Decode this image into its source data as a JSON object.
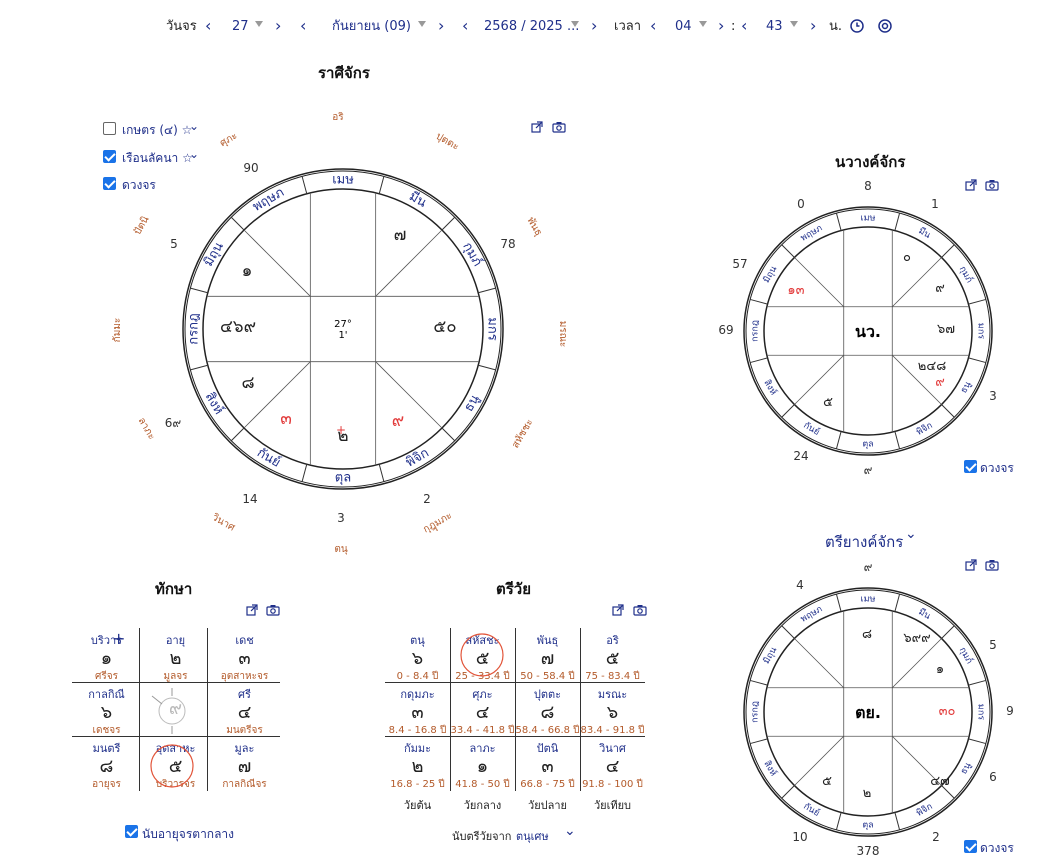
{
  "toolbar": {
    "day_label": "วันจร",
    "day_value": "27",
    "month_value": "กันยายน (09)",
    "year_value": "2568 / 2025 ...",
    "time_label": "เวลา",
    "hour_value": "04",
    "colon": ":",
    "minute_value": "43",
    "suffix": "น."
  },
  "rasi": {
    "title": "ราศีจักร",
    "options": [
      {
        "label": "เกษตร (๔) ☆",
        "checked": false
      },
      {
        "label": "เรือนลัคนา ☆",
        "checked": true
      },
      {
        "label": "ดวงจร",
        "checked": true
      }
    ],
    "signs": [
      "เมษ",
      "มีน",
      "กุมภ์",
      "มกร",
      "ธนู",
      "พิจิก",
      "ตุล",
      "กันย์",
      "สิงห์",
      "กรกฎ",
      "มิถุน",
      "พฤษภ"
    ],
    "center_deg": "27°",
    "center_min": "1'",
    "house_nums": [
      "๗",
      "๕๐",
      "๙",
      "๒",
      "๓",
      "๘",
      "๔๖๙",
      "๑"
    ],
    "outer_nums": [
      "90",
      "78",
      "5",
      "6๙",
      "14",
      "3",
      "2"
    ],
    "outer_words": [
      "อริ",
      "ปุตตะ",
      "พันธุ",
      "มรณะ",
      "สหัชชะ",
      "กุฎุมภะ",
      "ตนุ",
      "วินาศ",
      "ลาภะ",
      "กัมมะ",
      "ปัตนิ",
      "ศุภะ"
    ]
  },
  "navang": {
    "title": "นวางค์จักร",
    "center": "นว.",
    "signs": [
      "เมษ",
      "มีน",
      "กุมภ์",
      "มกร",
      "ธนู",
      "พิจิก",
      "ตุล",
      "กันย์",
      "สิงห์",
      "กรกฎ",
      "มิถุน",
      "พฤษภ"
    ],
    "outer_nums": [
      "8",
      "1",
      "0",
      "57",
      "69",
      "3",
      "24",
      "๙"
    ],
    "houses": [
      "๐",
      "๙",
      "๖๗",
      "๒๔๘",
      "๙",
      "๕",
      "๑๓"
    ],
    "checkbox": "ดวงจร"
  },
  "triyang": {
    "title": "ตรียางค์จักร",
    "center": "ตย.",
    "signs": [
      "เมษ",
      "มีน",
      "กุมภ์",
      "มกร",
      "ธนู",
      "พิจิก",
      "ตุล",
      "กันย์",
      "สิงห์",
      "กรกฎ",
      "มิถุน",
      "พฤษภ"
    ],
    "outer_nums": [
      "๙",
      "4",
      "5",
      "9",
      "6",
      "10",
      "2",
      "378"
    ],
    "houses": [
      "๘",
      "๖๙๙",
      "๑",
      "๓๐",
      "๔๗",
      "๒",
      "๕"
    ],
    "checkbox": "ดวงจร"
  },
  "taksa": {
    "title": "ทักษา",
    "cells": [
      {
        "t": "บริวาร",
        "n": "๑",
        "b": "ศรีจร"
      },
      {
        "t": "อายุ",
        "n": "๒",
        "b": "มูลจร"
      },
      {
        "t": "เดช",
        "n": "๓",
        "b": "อุตสาหะจร"
      },
      {
        "t": "กาลกิณี",
        "n": "๖",
        "b": "เดชจร"
      },
      {
        "t": "",
        "n": "๙",
        "b": ""
      },
      {
        "t": "ศรี",
        "n": "๔",
        "b": "มนตรีจร"
      },
      {
        "t": "มนตรี",
        "n": "๘",
        "b": "อายุจร"
      },
      {
        "t": "อุตสาหะ",
        "n": "๕",
        "b": "บริวารจร"
      },
      {
        "t": "มูละ",
        "n": "๗",
        "b": "กาลกิณีจร"
      }
    ],
    "footer": "นับอายุจรตากลาง"
  },
  "trivai": {
    "title": "ตรีวัย",
    "cells": [
      {
        "t": "ตนุ",
        "n": "๖",
        "b": "0 - 8.4 ปี"
      },
      {
        "t": "สหัสชะ",
        "n": "๕",
        "b": "25 - 33.4 ปี"
      },
      {
        "t": "พันธุ",
        "n": "๗",
        "b": "50 - 58.4 ปี"
      },
      {
        "t": "อริ",
        "n": "๕",
        "b": "75 - 83.4 ปี"
      },
      {
        "t": "กดุมภะ",
        "n": "๓",
        "b": "8.4 - 16.8 ปี"
      },
      {
        "t": "ศุภะ",
        "n": "๔",
        "b": "33.4 - 41.8 ปี"
      },
      {
        "t": "ปุตตะ",
        "n": "๘",
        "b": "58.4 - 66.8 ปี"
      },
      {
        "t": "มรณะ",
        "n": "๖",
        "b": "83.4 - 91.8 ปี"
      },
      {
        "t": "กัมมะ",
        "n": "๒",
        "b": "16.8 - 25 ปี"
      },
      {
        "t": "ลาภะ",
        "n": "๑",
        "b": "41.8 - 50 ปี"
      },
      {
        "t": "ปัตนิ",
        "n": "๓",
        "b": "66.8 - 75 ปี"
      },
      {
        "t": "วินาศ",
        "n": "๔",
        "b": "91.8 - 100 ปี"
      }
    ],
    "ages": [
      "วัยต้น",
      "วัยกลาง",
      "วัยปลาย",
      "วัยเทียบ"
    ],
    "footer_label": "นับตรีวัยจาก",
    "footer_value": "ตนุเศษ"
  }
}
